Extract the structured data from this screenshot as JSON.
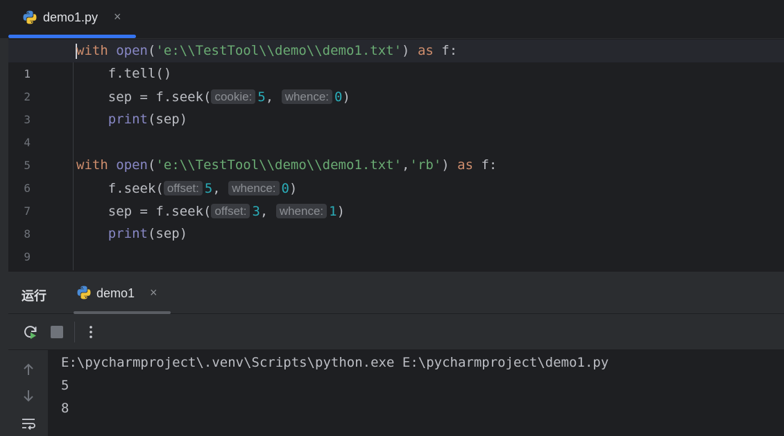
{
  "editor_tab": {
    "filename": "demo1.py",
    "close": "×",
    "icon": "python-icon"
  },
  "editor": {
    "line_numbers": [
      "1",
      "2",
      "3",
      "4",
      "5",
      "6",
      "7",
      "8",
      "9"
    ]
  },
  "run_panel": {
    "title": "运行",
    "tab_label": "demo1",
    "tab_close": "×",
    "toolbar": [
      "rerun-icon",
      "stop-icon",
      "more-icon"
    ],
    "side_tools": [
      "up-arrow-icon",
      "down-arrow-icon",
      "soft-wrap-icon"
    ],
    "output": [
      "E:\\pycharmproject\\.venv\\Scripts\\python.exe E:\\pycharmproject\\demo1.py",
      "5",
      "8"
    ]
  },
  "colors": {
    "accent": "#3574f0",
    "keyword": "#cf8e6d",
    "builtin": "#8888c6",
    "string": "#6aab73",
    "number": "#2aacb8",
    "background": "#1e1f22",
    "panel": "#2b2d30"
  }
}
